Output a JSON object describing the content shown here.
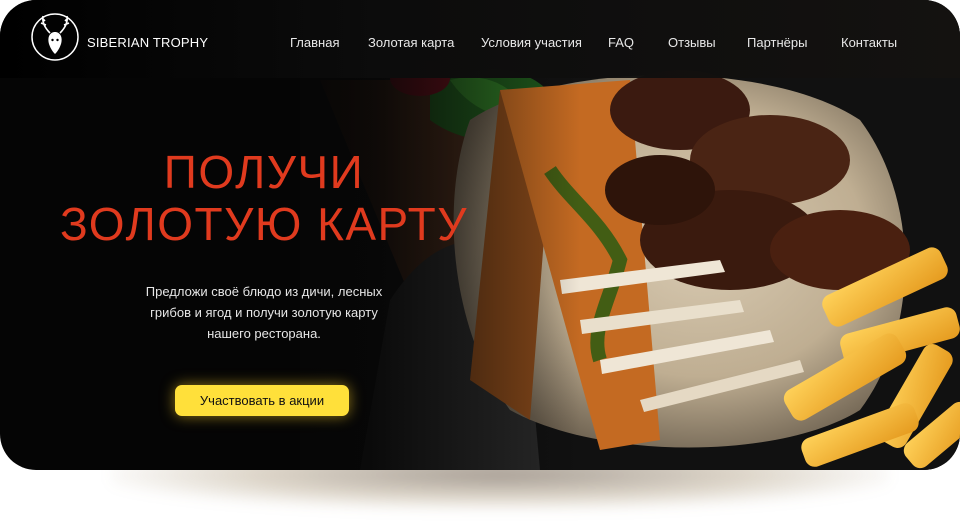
{
  "brand": {
    "name": "SIBERIAN TROPHY",
    "logo_icon": "deer-head-icon"
  },
  "nav": {
    "items": [
      {
        "label": "Главная"
      },
      {
        "label": "Золотая карта"
      },
      {
        "label": "Условия участия"
      },
      {
        "label": "FAQ"
      },
      {
        "label": "Отзывы"
      },
      {
        "label": "Партнёры"
      },
      {
        "label": "Контакты"
      }
    ]
  },
  "hero": {
    "title_line1": "ПОЛУЧИ",
    "title_line2": "ЗОЛОТУЮ КАРТУ",
    "subtitle_line1": "Предложи своё блюдо из дичи, лесных",
    "subtitle_line2": "грибов и ягод и получи золотую карту",
    "subtitle_line3": "нашего ресторана.",
    "cta_label": "Участвовать в акции",
    "image": "grilled-ribs-with-fries-photo"
  },
  "colors": {
    "background": "#050505",
    "title": "#e03a1e",
    "cta": "#ffe03a",
    "text": "#e6e6e6"
  }
}
